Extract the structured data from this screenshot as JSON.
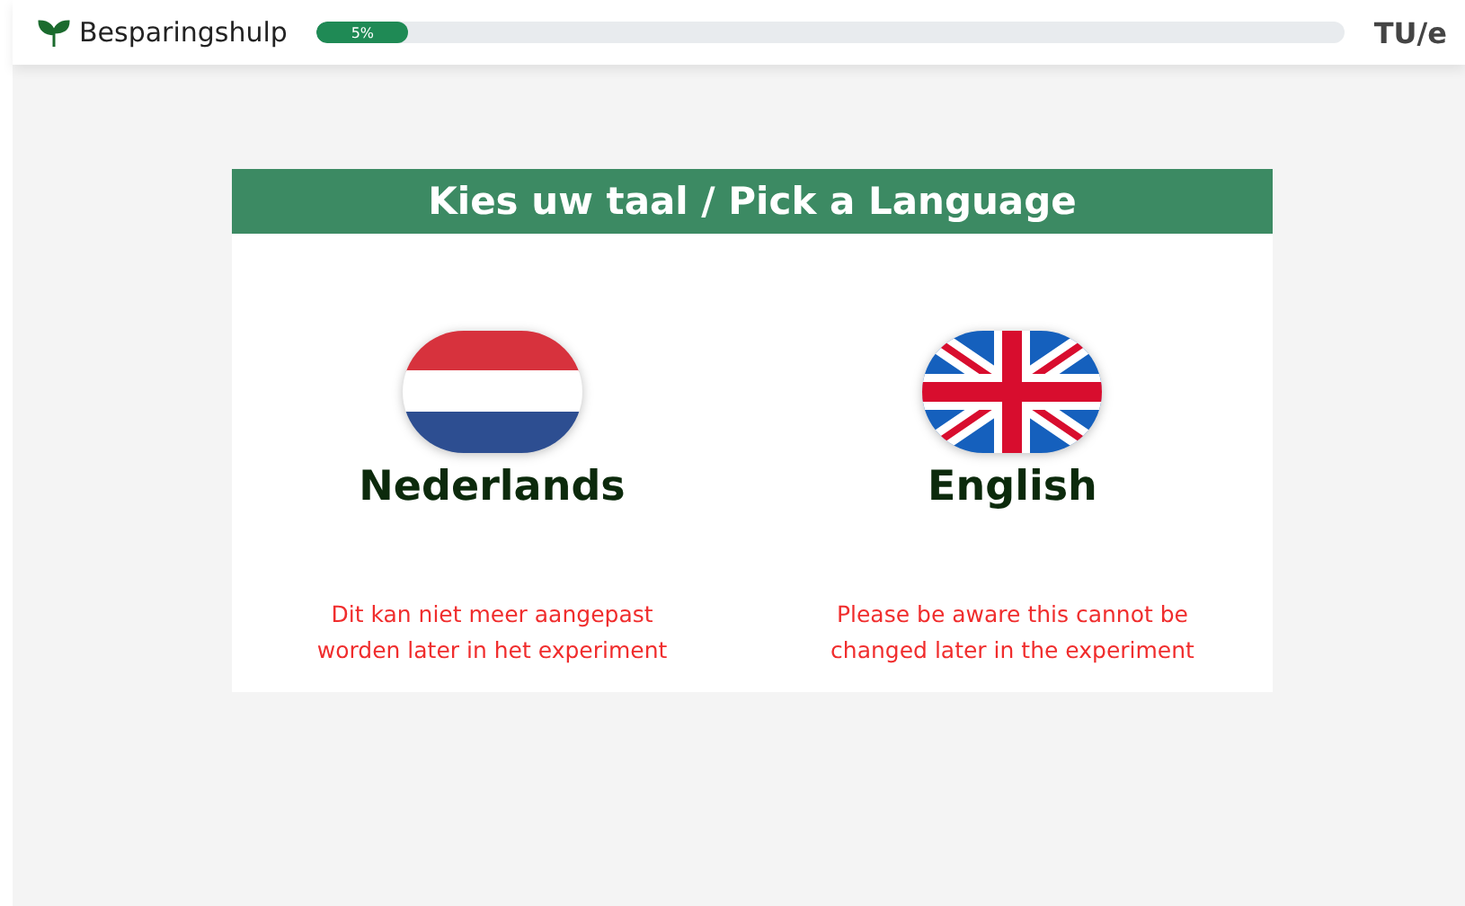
{
  "header": {
    "app_name": "Besparingshulp",
    "progress": {
      "label": "5%",
      "level": 0.09
    },
    "logo": "TU/e"
  },
  "panel": {
    "title": "Kies uw taal / Pick a Language",
    "languages": [
      {
        "kind": "dutch",
        "name": "Nederlands",
        "warning": "Dit kan niet meer aangepast worden later in het experiment"
      },
      {
        "kind": "british",
        "name": "English",
        "warning": "Please be aware this cannot be changed later in the experiment"
      }
    ]
  }
}
